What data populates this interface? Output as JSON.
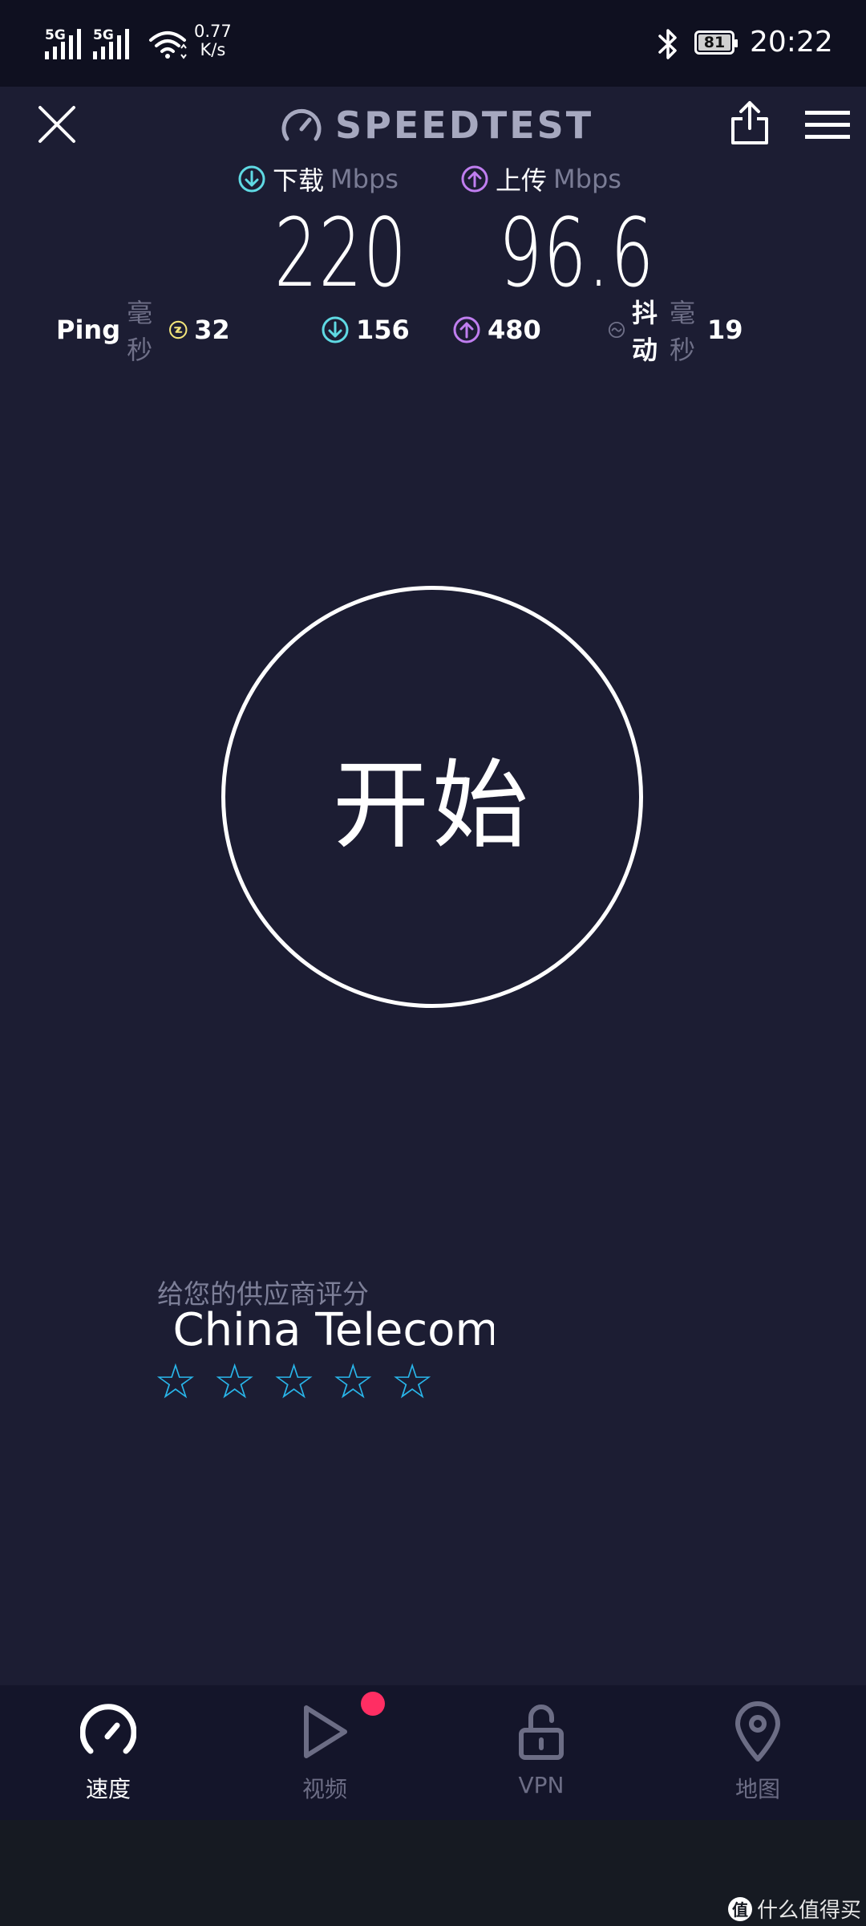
{
  "status_bar": {
    "sim1_label": "5G",
    "sim2_label": "5G",
    "net_speed_value": "0.77",
    "net_speed_unit": "K/s",
    "battery": "81",
    "time": "20:22"
  },
  "header": {
    "title": "SPEEDTEST"
  },
  "results": {
    "download_label": "下载",
    "download_unit": "Mbps",
    "download_value": "220",
    "upload_label": "上传",
    "upload_unit": "Mbps",
    "upload_value": "96.6"
  },
  "ping_row": {
    "ping_label": "Ping",
    "ping_unit": "毫秒",
    "ping_idle": "32",
    "ping_download": "156",
    "ping_upload": "480",
    "jitter_label": "抖动",
    "jitter_unit": "毫秒",
    "jitter_value": "19"
  },
  "start_button": {
    "label": "开始"
  },
  "rating": {
    "prompt": "给您的供应商评分",
    "provider": "China Telecom",
    "stars": [
      "☆",
      "☆",
      "☆",
      "☆",
      "☆"
    ]
  },
  "bottom_nav": {
    "items": [
      {
        "label": "速度",
        "icon": "speedometer-icon",
        "active": true
      },
      {
        "label": "视频",
        "icon": "play-icon",
        "active": false
      },
      {
        "label": "VPN",
        "icon": "unlock-icon",
        "active": false
      },
      {
        "label": "地图",
        "icon": "map-pin-icon",
        "active": false
      }
    ]
  },
  "watermark": {
    "logo": "值",
    "text": "什么值得买"
  },
  "colors": {
    "background": "#1c1d33",
    "download_accent": "#5fd9e3",
    "upload_accent": "#c07ef0",
    "ping_accent": "#f3e57a",
    "star": "#29b6ea",
    "video_badge": "#ff2e63"
  }
}
